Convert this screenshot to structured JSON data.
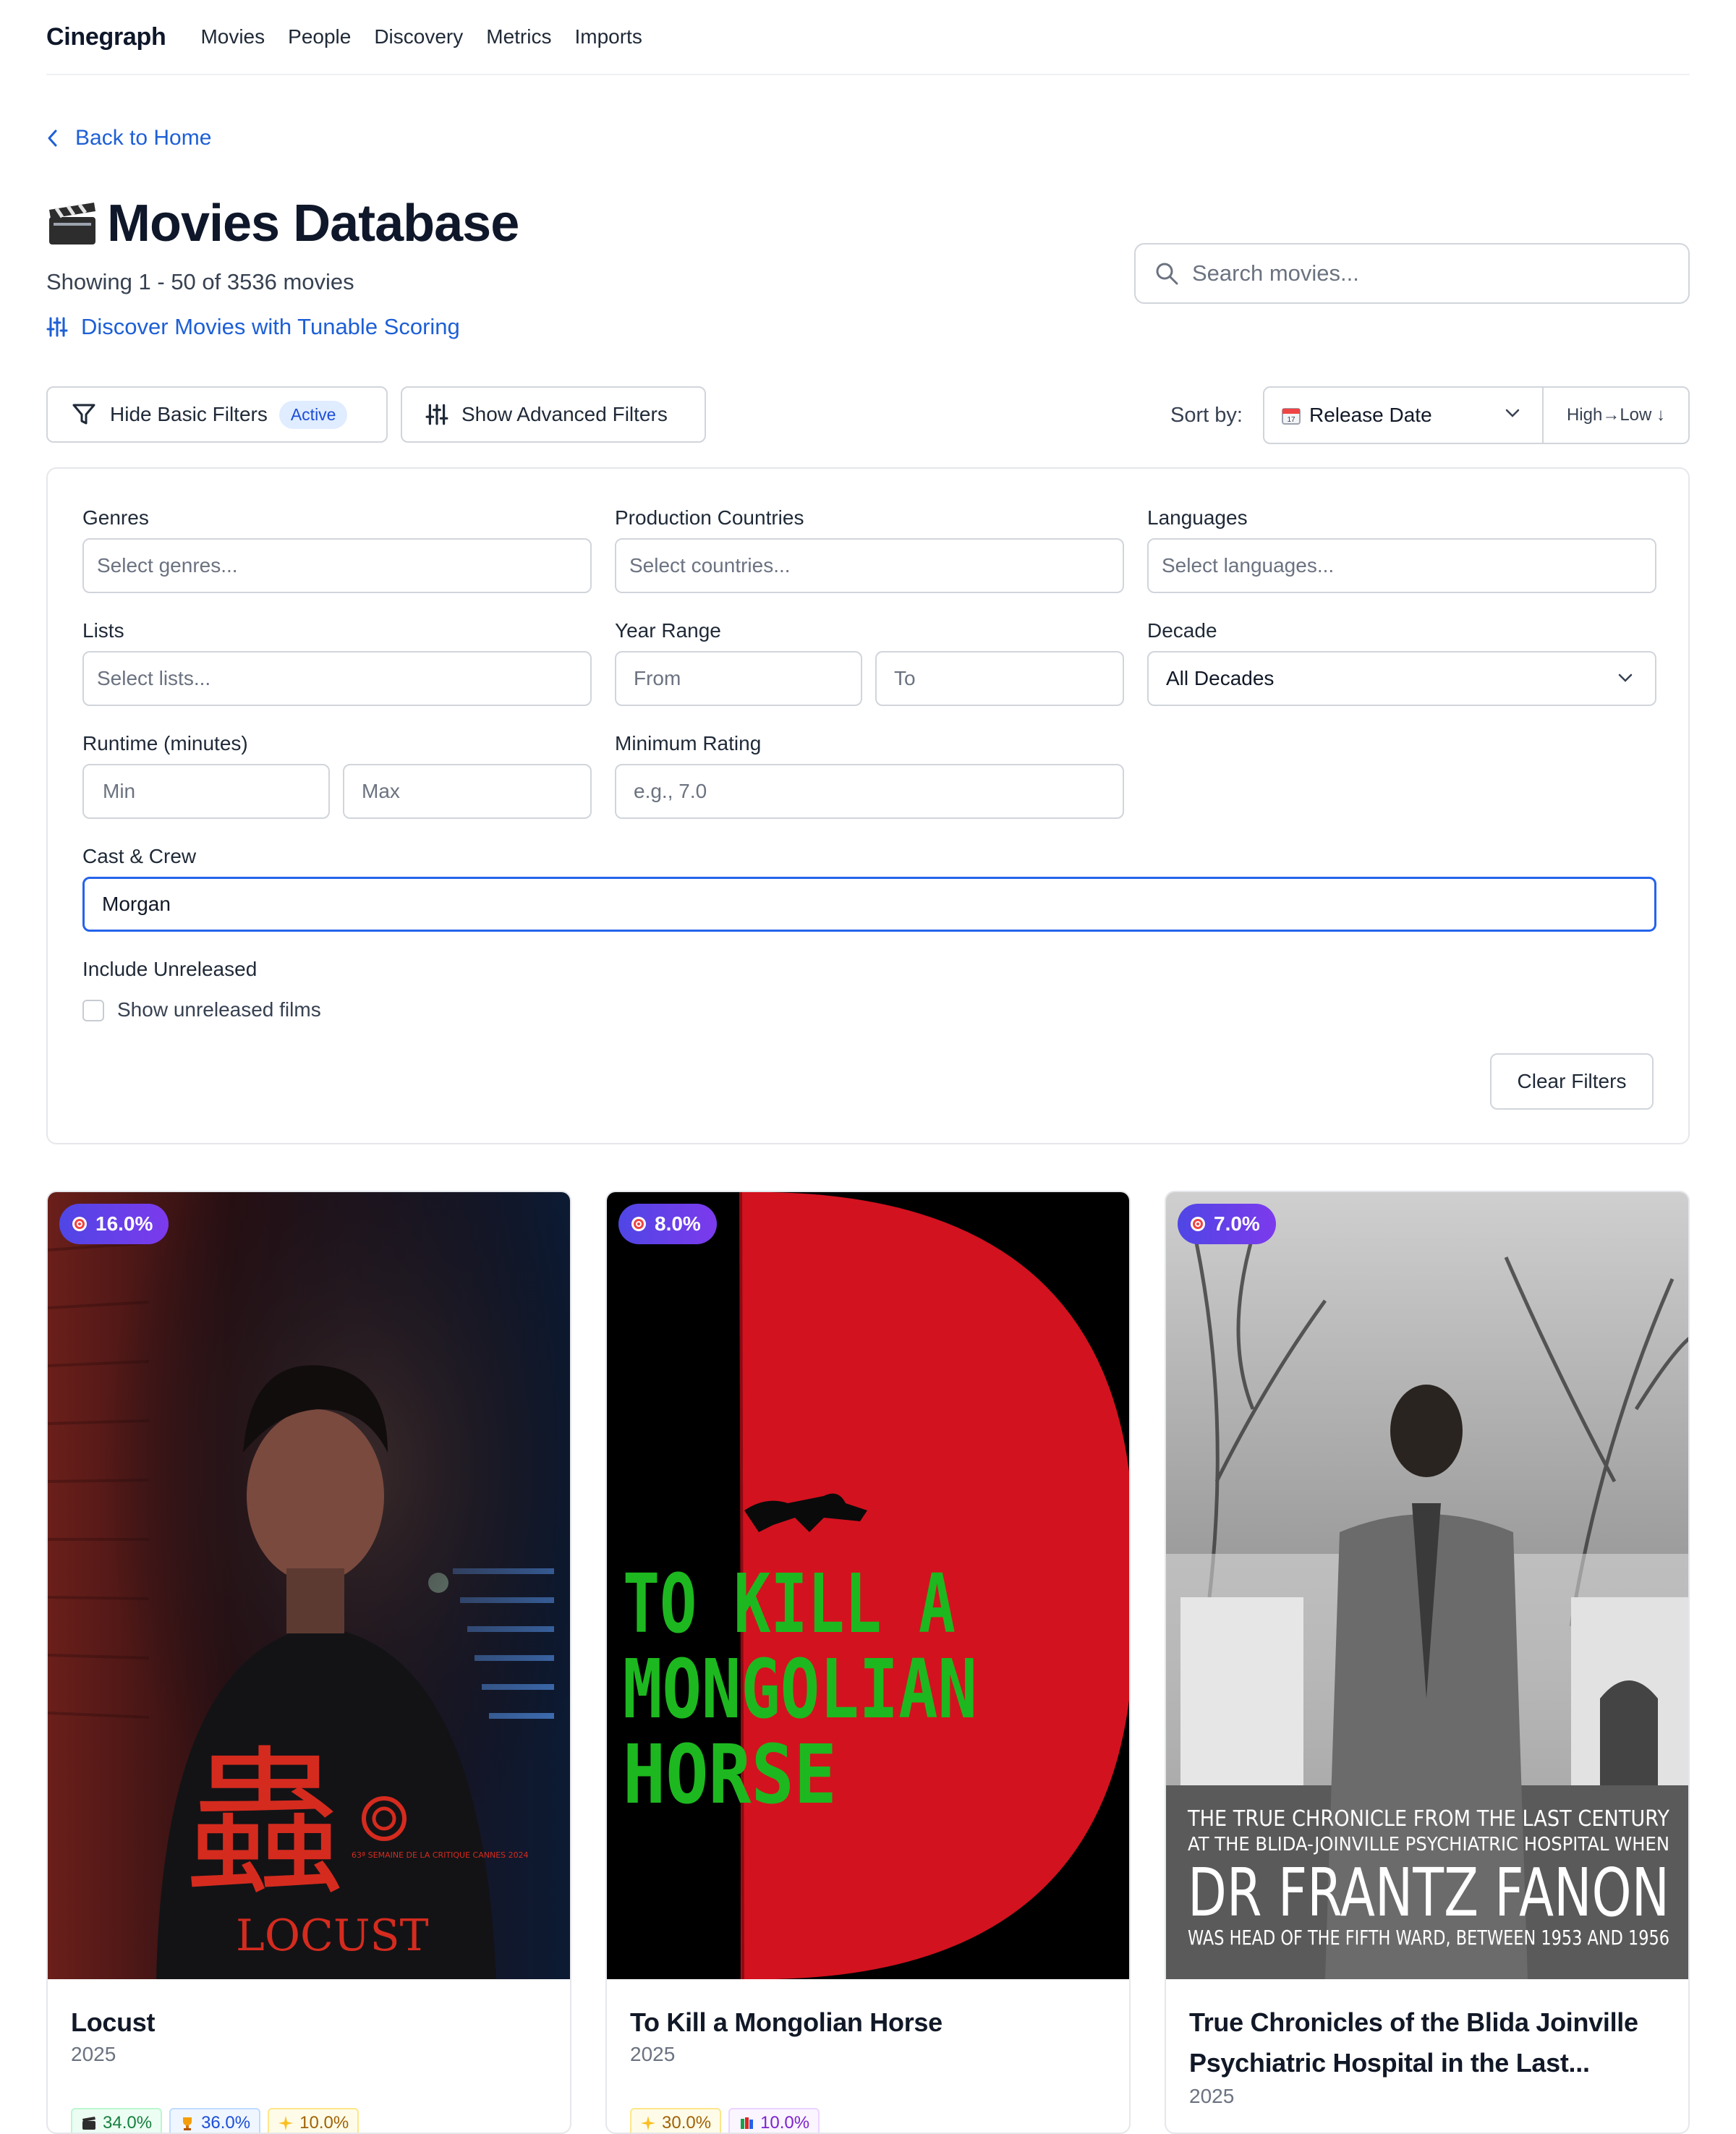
{
  "nav": {
    "brand": "Cinegraph",
    "links": [
      "Movies",
      "People",
      "Discovery",
      "Metrics",
      "Imports"
    ]
  },
  "back_label": "Back to Home",
  "page": {
    "title": "Movies Database",
    "showing": "Showing 1 - 50 of 3536 movies",
    "discover_link": "Discover Movies with Tunable Scoring"
  },
  "search": {
    "placeholder": "Search movies..."
  },
  "toolbar": {
    "hide_basic": "Hide Basic Filters",
    "active_badge": "Active",
    "show_advanced": "Show Advanced Filters",
    "sort_label": "Sort by:",
    "sort_value": "Release Date",
    "sort_direction": "High→Low ↓"
  },
  "filters": {
    "genres": {
      "label": "Genres",
      "placeholder": "Select genres..."
    },
    "countries": {
      "label": "Production Countries",
      "placeholder": "Select countries..."
    },
    "languages": {
      "label": "Languages",
      "placeholder": "Select languages..."
    },
    "lists": {
      "label": "Lists",
      "placeholder": "Select lists..."
    },
    "year_range": {
      "label": "Year Range",
      "from": "From",
      "to": "To"
    },
    "decade": {
      "label": "Decade",
      "value": "All Decades"
    },
    "runtime": {
      "label": "Runtime (minutes)",
      "min": "Min",
      "max": "Max"
    },
    "min_rating": {
      "label": "Minimum Rating",
      "placeholder": "e.g., 7.0"
    },
    "cast_crew": {
      "label": "Cast & Crew",
      "value": "Morgan"
    },
    "unreleased": {
      "label": "Include Unreleased",
      "checkbox_label": "Show unreleased films",
      "checked": false
    },
    "clear": "Clear Filters"
  },
  "movies": [
    {
      "title": "Locust",
      "year": "2025",
      "score": "16.0%",
      "poster_text": {
        "glyph": "蟲",
        "name": "LOCUST",
        "festival": "63ª SEMAINE DE LA CRITIQUE CANNES 2024"
      },
      "chips": [
        {
          "icon": "clapper-icon",
          "value": "34.0%",
          "color": "green"
        },
        {
          "icon": "trophy-icon",
          "value": "36.0%",
          "color": "blue"
        },
        {
          "icon": "sparkle-icon",
          "value": "10.0%",
          "color": "yellow"
        }
      ]
    },
    {
      "title": "To Kill a Mongolian Horse",
      "year": "2025",
      "score": "8.0%",
      "poster_text": {
        "line1": "TO KILL A",
        "line2": "MONGOLIAN",
        "line3": "HORSE"
      },
      "chips": [
        {
          "icon": "sparkle-icon",
          "value": "30.0%",
          "color": "yellow"
        },
        {
          "icon": "books-icon",
          "value": "10.0%",
          "color": "purple"
        }
      ]
    },
    {
      "title": "True Chronicles of the Blida Joinville Psychiatric Hospital in the Last...",
      "year": "2025",
      "score": "7.0%",
      "poster_text": {
        "line1": "THE TRUE CHRONICLE FROM THE LAST CENTURY",
        "line2": "AT THE BLIDA-JOINVILLE PSYCHIATRIC HOSPITAL WHEN",
        "line3": "DR FRANTZ FANON",
        "line4": "WAS HEAD OF THE FIFTH WARD, BETWEEN 1953 AND 1956"
      },
      "chips": []
    }
  ]
}
